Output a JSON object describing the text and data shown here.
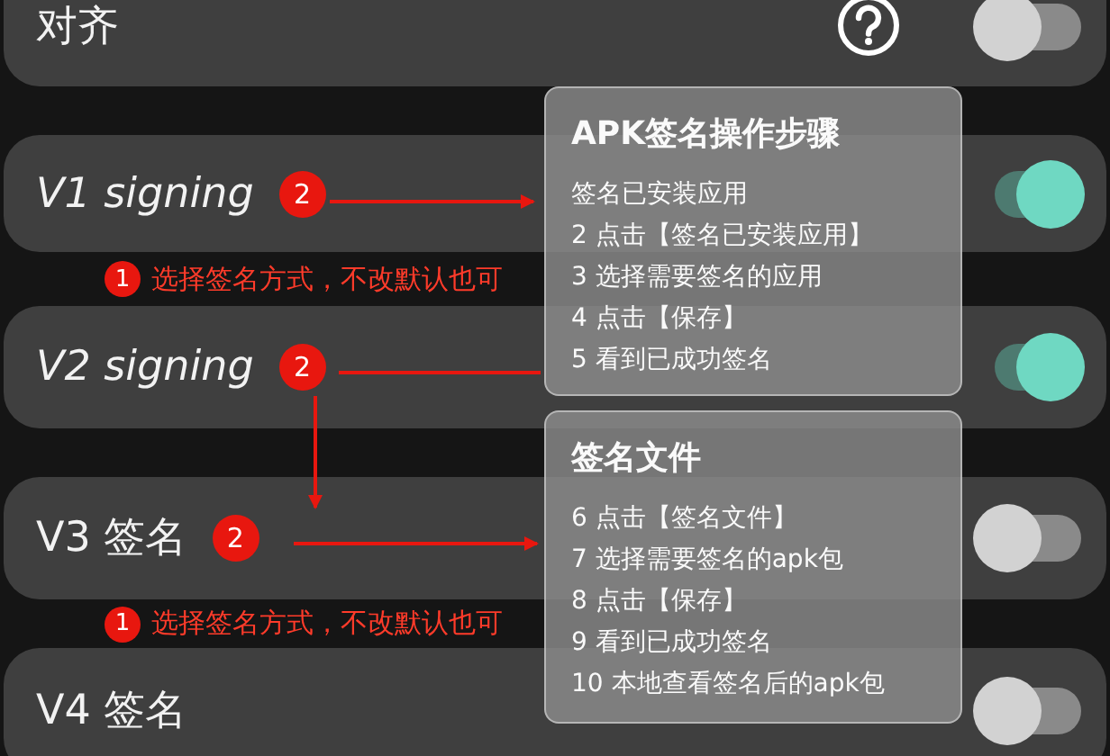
{
  "rows": [
    {
      "label": "对齐",
      "italic": false,
      "help": true,
      "on": false
    },
    {
      "label": "V1 signing",
      "italic": true,
      "help": false,
      "on": true,
      "badge": "2",
      "note": {
        "number": "1",
        "text": "选择签名方式，不改默认也可"
      }
    },
    {
      "label": "V2 signing",
      "italic": true,
      "help": false,
      "on": true,
      "badge": "2"
    },
    {
      "label": "V3 签名",
      "italic": false,
      "help": false,
      "on": false,
      "badge": "2",
      "note": {
        "number": "1",
        "text": "选择签名方式，不改默认也可"
      }
    },
    {
      "label": "V4 签名",
      "italic": false,
      "help": false,
      "on": false
    }
  ],
  "panels": [
    {
      "title": "APK签名操作步骤",
      "steps": [
        "签名已安装应用",
        "2 点击【签名已安装应用】",
        "3 选择需要签名的应用",
        "4 点击【保存】",
        "5 看到已成功签名"
      ]
    },
    {
      "title": "签名文件",
      "steps": [
        "6 点击【签名文件】",
        "7 选择需要签名的apk包",
        "8 点击【保存】",
        "9 看到已成功签名",
        "10 本地查看签名后的apk包"
      ]
    }
  ]
}
